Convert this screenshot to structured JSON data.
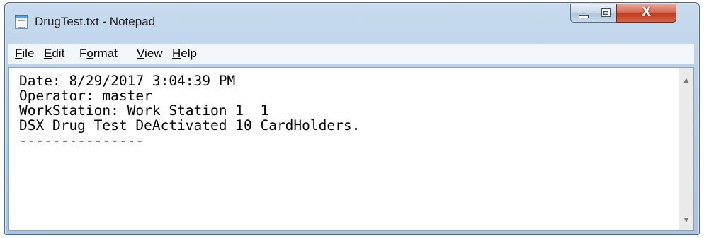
{
  "window": {
    "title": "DrugTest.txt - Notepad"
  },
  "menu": {
    "items": [
      {
        "underline": "F",
        "rest": "ile"
      },
      {
        "underline": "E",
        "rest": "dit"
      },
      {
        "pre": "F",
        "underline": "o",
        "rest": "rmat"
      },
      {
        "underline": "V",
        "rest": "iew"
      },
      {
        "underline": "H",
        "rest": "elp"
      }
    ]
  },
  "document": {
    "lines": [
      "Date: 8/29/2017 3:04:39 PM",
      "Operator: master",
      "WorkStation: Work Station 1  1",
      "DSX Drug Test DeActivated 10 CardHolders.",
      "---------------"
    ]
  },
  "icons": {
    "app": "notepad-icon",
    "minimize": "minimize-icon",
    "maximize": "maximize-icon",
    "close": "close-icon",
    "scroll_up": "scroll-up-arrow-icon",
    "scroll_down": "scroll-down-arrow-icon"
  },
  "colors": {
    "titlebar": "#b3cde6",
    "close_button": "#c0391f",
    "menubar": "#f2f5fa",
    "editor_bg": "#ffffff"
  }
}
